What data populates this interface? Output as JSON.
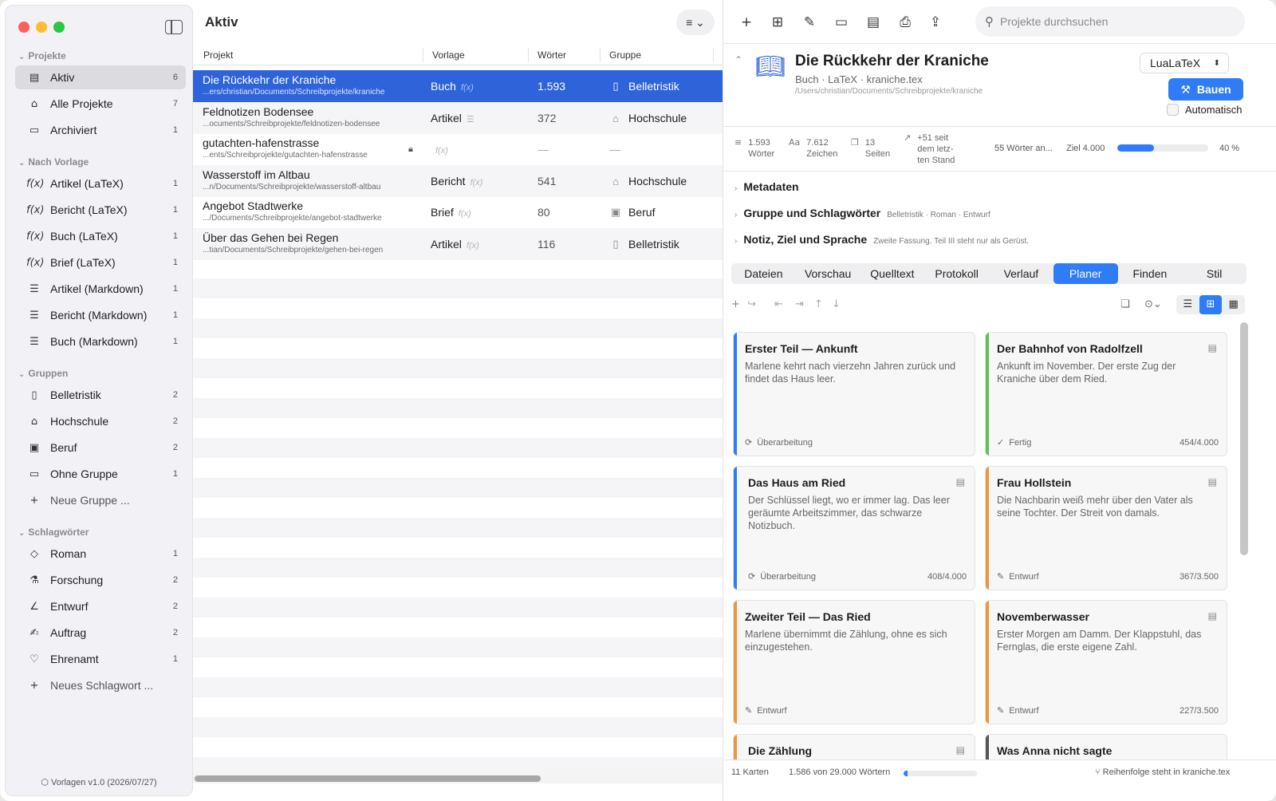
{
  "sidebar": {
    "sections": [
      "Projekte",
      "Nach Vorlage",
      "Gruppen",
      "Schlagwörter"
    ],
    "projekte": [
      {
        "label": "Aktiv",
        "count": "6",
        "icon": "doc-stack-icon"
      },
      {
        "label": "Alle Projekte",
        "count": "7",
        "icon": "tray-icon"
      },
      {
        "label": "Archiviert",
        "count": "1",
        "icon": "archive-icon"
      }
    ],
    "vorlagen": [
      {
        "label": "Artikel (LaTeX)",
        "count": "1"
      },
      {
        "label": "Bericht (LaTeX)",
        "count": "1"
      },
      {
        "label": "Buch (LaTeX)",
        "count": "1"
      },
      {
        "label": "Brief (LaTeX)",
        "count": "1"
      },
      {
        "label": "Artikel (Markdown)",
        "count": "1"
      },
      {
        "label": "Bericht (Markdown)",
        "count": "1"
      },
      {
        "label": "Buch (Markdown)",
        "count": "1"
      }
    ],
    "gruppen": [
      {
        "label": "Belletristik",
        "count": "2"
      },
      {
        "label": "Hochschule",
        "count": "2"
      },
      {
        "label": "Beruf",
        "count": "2"
      },
      {
        "label": "Ohne Gruppe",
        "count": "1"
      }
    ],
    "new_group": "Neue Gruppe ...",
    "tags": [
      {
        "label": "Roman",
        "count": "1"
      },
      {
        "label": "Forschung",
        "count": "2"
      },
      {
        "label": "Entwurf",
        "count": "2"
      },
      {
        "label": "Auftrag",
        "count": "2"
      },
      {
        "label": "Ehrenamt",
        "count": "1"
      }
    ],
    "new_tag": "Neues Schlagwort ...",
    "footer": "Vorlagen v1.0 (2026/07/27)"
  },
  "list": {
    "title": "Aktiv",
    "headers": [
      "Projekt",
      "Vorlage",
      "Wörter",
      "Gruppe"
    ],
    "rows": [
      {
        "name": "Die Rückkehr der Kraniche",
        "path": "...ers/christian/Documents/Schreibprojekte/kraniche",
        "template": "Buch",
        "words": "1.593",
        "group": "Belletristik"
      },
      {
        "name": "Feldnotizen Bodensee",
        "path": "...ocuments/Schreibprojekte/feldnotizen-bodensee",
        "template": "Artikel",
        "words": "372",
        "group": "Hochschule"
      },
      {
        "name": "gutachten-hafenstrasse",
        "path": "...ents/Schreibprojekte/gutachten-hafenstrasse",
        "template": "",
        "words": "—",
        "group": "—"
      },
      {
        "name": "Wasserstoff im Altbau",
        "path": "...n/Documents/Schreibprojekte/wasserstoff-altbau",
        "template": "Bericht",
        "words": "541",
        "group": "Hochschule"
      },
      {
        "name": "Angebot Stadtwerke",
        "path": ".../Documents/Schreibprojekte/angebot-stadtwerke",
        "template": "Brief",
        "words": "80",
        "group": "Beruf"
      },
      {
        "name": "Über das Gehen bei Regen",
        "path": "...tian/Documents/Schreibprojekte/gehen-bei-regen",
        "template": "Artikel",
        "words": "116",
        "group": "Belletristik"
      }
    ]
  },
  "detail": {
    "search_placeholder": "Projekte durchsuchen",
    "title": "Die Rückkehr der Kraniche",
    "subtitle": "Buch · LaTeX · kraniche.tex",
    "path": "/Users/christian/Documents/Schreibprojekte/kraniche",
    "engine": "LuaLaTeX",
    "build_label": "Bauen",
    "auto_label": "Automatisch",
    "stats": {
      "words_val": "1.593",
      "words_lbl": "Wörter",
      "chars_val": "7.612",
      "chars_lbl": "Zeichen",
      "pages_val": "13",
      "pages_lbl": "Seiten",
      "delta_1": "+51 seit",
      "delta_2": "dem letz-",
      "delta_3": "ten Stand",
      "goal_text": "55 Wörter an...",
      "goal_label": "Ziel 4.000",
      "goal_pct": "40 %",
      "goal_fraction": 0.4
    },
    "disclosures": [
      {
        "label": "Metadaten",
        "small": ""
      },
      {
        "label": "Gruppe und Schlagwörter",
        "small": "Belletristik · Roman · Entwurf"
      },
      {
        "label": "Notiz, Ziel und Sprache",
        "small": "Zweite Fassung. Teil III steht nur als Gerüst."
      }
    ],
    "tabs": [
      "Dateien",
      "Vorschau",
      "Quelltext",
      "Protokoll",
      "Verlauf",
      "Planer",
      "Finden",
      "Stil"
    ],
    "active_tab": "Planer",
    "cards": [
      {
        "title": "Erster Teil — Ankunft",
        "desc": "Marlene kehrt nach vierzehn Jahren zurück und findet das Haus leer.",
        "status": "Überarbeitung",
        "words": "",
        "color": "#2f7cf6"
      },
      {
        "title": "Der Bahnhof von Radolfzell",
        "desc": "Ankunft im November. Der erste Zug der Kraniche über dem Ried.",
        "status": "Fertig",
        "words": "454/4.000",
        "color": "#5cc15a"
      },
      {
        "title": "Das Haus am Ried",
        "desc": "Der Schlüssel liegt, wo er immer lag. Das leer geräumte Arbeitszimmer, das schwarze Notizbuch.",
        "status": "Überarbeitung",
        "words": "408/4.000",
        "color": "#2f7cf6"
      },
      {
        "title": "Frau Hollstein",
        "desc": "Die Nachbarin weiß mehr über den Vater als seine Tochter. Der Streit von damals.",
        "status": "Entwurf",
        "words": "367/3.500",
        "color": "#f0953a"
      },
      {
        "title": "Zweiter Teil — Das Ried",
        "desc": "Marlene übernimmt die Zählung, ohne es sich einzugestehen.",
        "status": "Entwurf",
        "words": "",
        "color": "#f0953a"
      },
      {
        "title": "Novemberwasser",
        "desc": "Erster Morgen am Damm. Der Klappstuhl, das Fernglas, die erste eigene Zahl.",
        "status": "Entwurf",
        "words": "227/3.500",
        "color": "#f0953a"
      },
      {
        "title": "Die Zählung",
        "desc": "",
        "status": "",
        "words": "",
        "color": "#f0953a"
      },
      {
        "title": "Was Anna nicht sagte",
        "desc": "",
        "status": "",
        "words": "",
        "color": "#555555"
      }
    ],
    "footer_cards": "11 Karten",
    "footer_words": "1.586 von 29.000 Wörtern",
    "footer_fraction": 0.055,
    "footer_order": "Reihenfolge steht in kraniche.tex"
  }
}
